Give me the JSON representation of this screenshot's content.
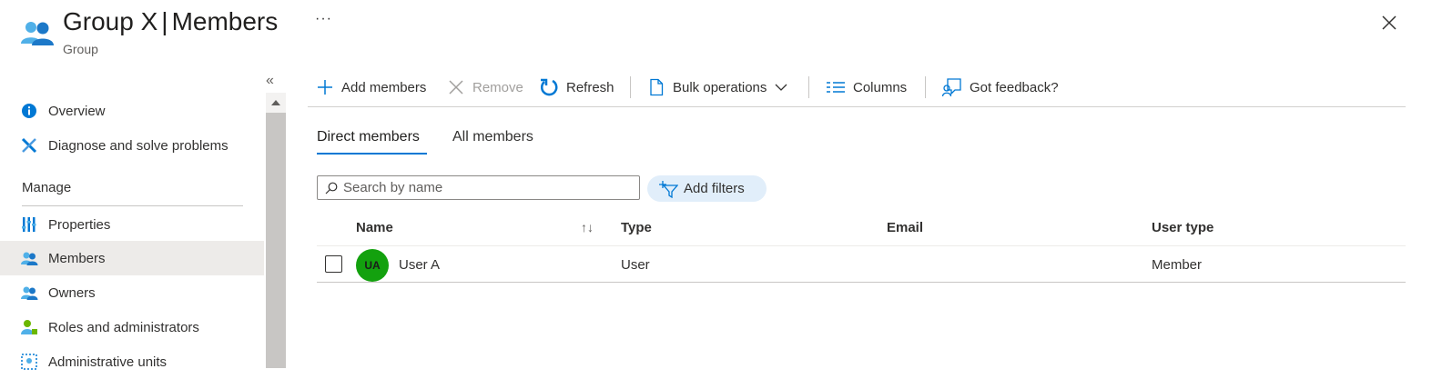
{
  "header": {
    "title_main": "Group X",
    "title_sep": "|",
    "title_page": "Members",
    "subtitle": "Group",
    "more_label": "···",
    "icon": "group-icon",
    "close_icon": "close-icon"
  },
  "sidebar": {
    "collapse_label": "«",
    "items_top": [
      {
        "label": "Overview",
        "icon": "info-icon"
      },
      {
        "label": "Diagnose and solve problems",
        "icon": "wrench-icon"
      }
    ],
    "section_label": "Manage",
    "items_manage": [
      {
        "label": "Properties",
        "icon": "properties-icon"
      },
      {
        "label": "Members",
        "icon": "members-icon",
        "active": true
      },
      {
        "label": "Owners",
        "icon": "owners-icon"
      },
      {
        "label": "Roles and administrators",
        "icon": "roles-icon"
      },
      {
        "label": "Administrative units",
        "icon": "admin-units-icon"
      }
    ]
  },
  "toolbar": {
    "add_members": "Add members",
    "remove": "Remove",
    "refresh": "Refresh",
    "bulk_operations": "Bulk operations",
    "columns": "Columns",
    "feedback": "Got feedback?"
  },
  "tabs": [
    {
      "label": "Direct members",
      "selected": true
    },
    {
      "label": "All members",
      "selected": false
    }
  ],
  "search": {
    "placeholder": "Search by name",
    "value": ""
  },
  "filters_label": "Add filters",
  "table": {
    "columns": [
      "Name",
      "Type",
      "Email",
      "User type"
    ],
    "sort_glyph": "↑↓",
    "rows": [
      {
        "initials": "UA",
        "name": "User A",
        "type": "User",
        "email": "",
        "user_type": "Member"
      }
    ]
  },
  "colors": {
    "accent": "#0078d4",
    "avatar": "#13a10e",
    "filter_pill": "#e1eefa"
  }
}
